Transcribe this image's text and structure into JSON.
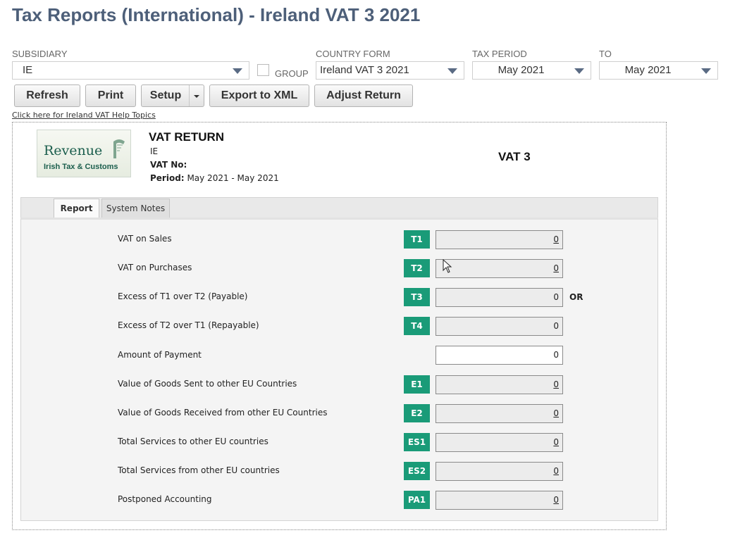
{
  "page": {
    "title": "Tax Reports (International) - Ireland VAT 3 2021"
  },
  "filters": {
    "subsidiary": {
      "label": "SUBSIDIARY",
      "value": "IE"
    },
    "group": {
      "label": "GROUP",
      "checked": false
    },
    "country_form": {
      "label": "COUNTRY FORM",
      "value": "Ireland VAT 3 2021"
    },
    "tax_period": {
      "label": "TAX PERIOD",
      "value": "May 2021"
    },
    "to": {
      "label": "TO",
      "value": "May 2021"
    }
  },
  "toolbar": {
    "refresh": "Refresh",
    "print": "Print",
    "setup": "Setup",
    "export": "Export to XML",
    "adjust": "Adjust Return"
  },
  "help_link": "Click here for Ireland VAT Help Topics",
  "header": {
    "logo_line1": "Revenue",
    "logo_line2": "Irish Tax & Customs",
    "title": "VAT RETURN",
    "subsidiary": "IE",
    "vat_no_label": "VAT No:",
    "period_label": "Period:",
    "period_value": "May 2021 - May 2021",
    "form_name": "VAT 3"
  },
  "tabs": [
    {
      "label": "Report",
      "active": true
    },
    {
      "label": "System Notes",
      "active": false
    }
  ],
  "rows": [
    {
      "label": "VAT on Sales",
      "code": "T1",
      "value": "0",
      "link": true
    },
    {
      "label": "VAT on Purchases",
      "code": "T2",
      "value": "0",
      "link": true
    },
    {
      "label": "Excess of T1 over T2 (Payable)",
      "code": "T3",
      "value": "0",
      "link": false,
      "suffix": "OR"
    },
    {
      "label": "Excess of T2 over T1 (Repayable)",
      "code": "T4",
      "value": "0",
      "link": false
    },
    {
      "label": "Amount of Payment",
      "code": "",
      "value": "0",
      "link": false,
      "editable": true
    },
    {
      "label": "Value of Goods Sent to other EU Countries",
      "code": "E1",
      "value": "0",
      "link": true
    },
    {
      "label": "Value of Goods Received from other EU Countries",
      "code": "E2",
      "value": "0",
      "link": true
    },
    {
      "label": "Total Services to other EU countries",
      "code": "ES1",
      "value": "0",
      "link": true
    },
    {
      "label": "Total Services from other EU countries",
      "code": "ES2",
      "value": "0",
      "link": true
    },
    {
      "label": "Postponed Accounting",
      "code": "PA1",
      "value": "0",
      "link": true
    }
  ],
  "colors": {
    "title": "#4d5f79",
    "badge": "#1a9b78",
    "caret": "#5a6b84"
  }
}
